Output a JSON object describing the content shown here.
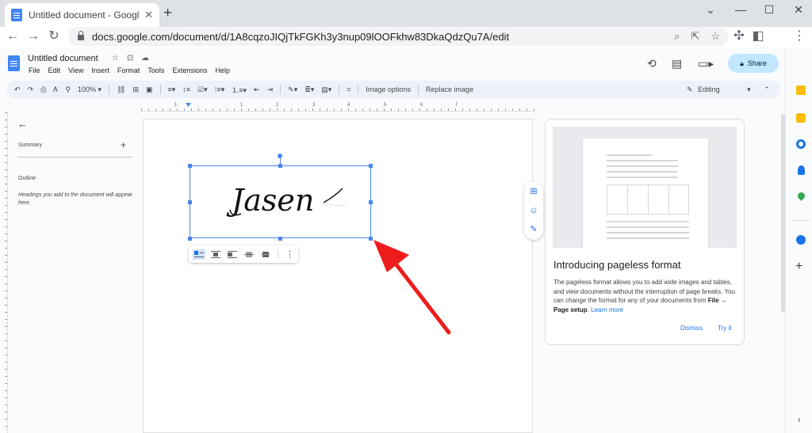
{
  "browser": {
    "tab_title": "Untitled document - Google D",
    "tab_close": "✕",
    "new_tab": "+",
    "url": "docs.google.com/document/d/1A8cqzoJIQjTkFGKh3y3nup09lOOFkhw83DkaQdzQu7A/edit",
    "window_controls": {
      "minimize": "⌄",
      "minimize2": "—",
      "maximize": "☐",
      "close": "✕"
    },
    "nav": {
      "back": "←",
      "forward": "→",
      "reload": "↻"
    },
    "omnibox_icons": [
      "zoom-icon",
      "share-icon",
      "star-icon"
    ]
  },
  "docs": {
    "title": "Untitled document",
    "menus": [
      "File",
      "Edit",
      "View",
      "Insert",
      "Format",
      "Tools",
      "Extensions",
      "Help"
    ],
    "share_label": "Share",
    "toolbar": {
      "zoom": "100%",
      "image_options": "Image options",
      "replace_image": "Replace image",
      "mode": "Editing"
    },
    "ruler_labels": [
      "1",
      "1",
      "2",
      "3",
      "4",
      "5",
      "6",
      "7"
    ]
  },
  "outline_panel": {
    "back": "←",
    "summary_label": "Summary",
    "summary_add": "+",
    "outline_label": "Outline",
    "outline_hint": "Headings you add to the document will appear here."
  },
  "document": {
    "image_text": "Jasen"
  },
  "pageless_card": {
    "title": "Introducing pageless format",
    "body_pre": "The pageless format allows you to add wide images and tables, and view documents without the interruption of page breaks. You can change the format for any of your documents from ",
    "body_bold": "File → Page setup",
    "body_post": ". ",
    "learn_more": "Learn more",
    "dismiss": "Dismiss",
    "try_it": "Try it"
  },
  "colors": {
    "accent": "#1a73e8",
    "selection": "#4a86e8",
    "share_bg": "#c2e7ff",
    "annotation_arrow": "#ee1c1c"
  }
}
